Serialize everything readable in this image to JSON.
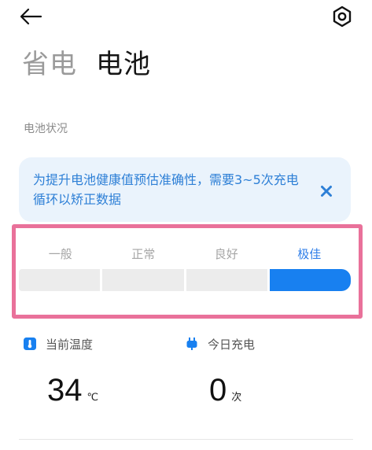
{
  "header": {
    "back_icon": "arrow-left-icon",
    "settings_icon": "gear-icon"
  },
  "tabs": [
    {
      "label": "省电",
      "active": false
    },
    {
      "label": "电池",
      "active": true
    }
  ],
  "section": {
    "title": "电池状况"
  },
  "notice": {
    "text": "为提升电池健康值预估准确性，需要3~5次充电循环以矫正数据",
    "close_icon": "close-icon"
  },
  "health_levels": {
    "labels": [
      "一般",
      "正常",
      "良好",
      "极佳"
    ],
    "current_index": 3
  },
  "stats": {
    "temperature": {
      "label": "当前温度",
      "value": "34",
      "unit": "℃",
      "icon": "thermometer-icon"
    },
    "charges_today": {
      "label": "今日充电",
      "value": "0",
      "unit": "次",
      "icon": "charging-plug-icon"
    }
  },
  "colors": {
    "accent": "#1880f0",
    "notice_bg": "#eaf3fc",
    "notice_text": "#2d7fd6",
    "highlight_border": "#e9719a",
    "inactive_bar": "#ececec"
  }
}
